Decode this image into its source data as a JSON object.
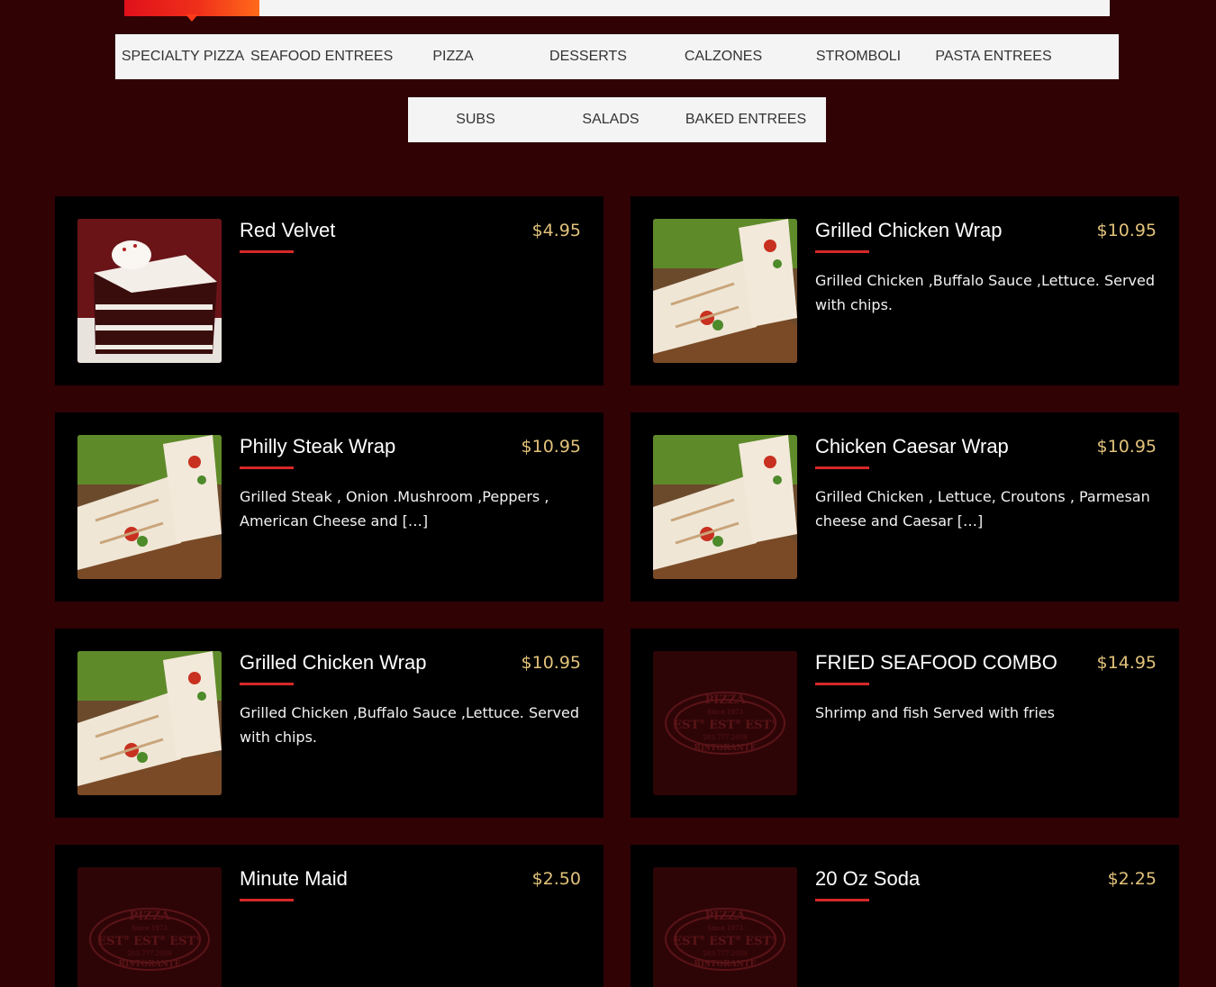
{
  "nav": {
    "row1": [
      "SPECIALTY PIZZA",
      "SEAFOOD ENTREES",
      "PIZZA",
      "DESSERTS",
      "CALZONES",
      "STROMBOLI",
      "PASTA ENTREES"
    ],
    "row2": [
      "SUBS",
      "SALADS",
      "BAKED ENTREES"
    ]
  },
  "items": [
    {
      "name": "Red Velvet",
      "price": "$4.95",
      "desc": ""
    },
    {
      "name": "Grilled Chicken Wrap",
      "price": "$10.95",
      "desc": "Grilled Chicken ,Buffalo Sauce ,Lettuce. Served with chips."
    },
    {
      "name": "Philly Steak Wrap",
      "price": "$10.95",
      "desc": "Grilled Steak , Onion .Mushroom ,Peppers , American Cheese and […]"
    },
    {
      "name": "Chicken Caesar Wrap",
      "price": "$10.95",
      "desc": "Grilled Chicken , Lettuce, Croutons , Parmesan cheese  and Caesar […]"
    },
    {
      "name": "Grilled Chicken Wrap",
      "price": "$10.95",
      "desc": "Grilled Chicken ,Buffalo Sauce ,Lettuce. Served with chips."
    },
    {
      "name": "FRIED SEAFOOD COMBO",
      "price": "$14.95",
      "desc": "Shrimp and fish Served with fries"
    },
    {
      "name": "Minute Maid",
      "price": "$2.50",
      "desc": ""
    },
    {
      "name": "20 Oz Soda",
      "price": "$2.25",
      "desc": ""
    }
  ],
  "logo": {
    "arc_top": "PIZZA",
    "since": "Since 1973",
    "brand": "EST° EST° EST°",
    "phone": "203.777.2059",
    "arc_bottom": "RISTORANTE"
  },
  "colors": {
    "background": "#300204",
    "card": "#000000",
    "price": "#e2c27a",
    "accent": "#d62828",
    "tab_bg": "#f4f4f4"
  }
}
